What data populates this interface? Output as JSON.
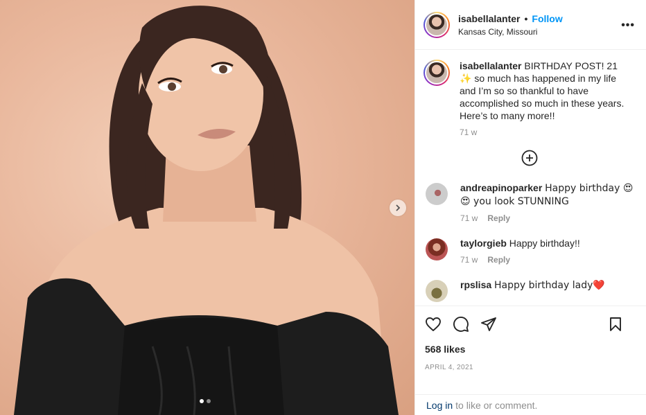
{
  "post": {
    "username": "isabellalanter",
    "follow_label": "Follow",
    "separator": "•",
    "location": "Kansas City, Missouri",
    "more_label": "•••"
  },
  "caption": {
    "username": "isabellalanter",
    "text": "BIRTHDAY POST! 21 ✨ so much has happened in my life and I’m so so thankful to have accomplished so much in these years. Here’s to many more!!",
    "time": "71 w"
  },
  "comments": [
    {
      "username": "andreapinoparker",
      "text": "Happy birthday 😍 😍 you look STUNNING",
      "time": "71 w",
      "reply": "Reply"
    },
    {
      "username": "taylorgieb",
      "text": "Happy birthday!!",
      "time": "71 w",
      "reply": "Reply"
    },
    {
      "username": "rpslisa",
      "text": "Happy birthday lady❤️"
    }
  ],
  "stats": {
    "likes": "568 likes",
    "date": "APRIL 4, 2021"
  },
  "login": {
    "link": "Log in",
    "rest": "to like or comment."
  },
  "carousel": {
    "count": 2,
    "active": 1
  },
  "colors": {
    "accent": "#0095f6",
    "text": "#262626",
    "muted": "#8e8e8e"
  }
}
